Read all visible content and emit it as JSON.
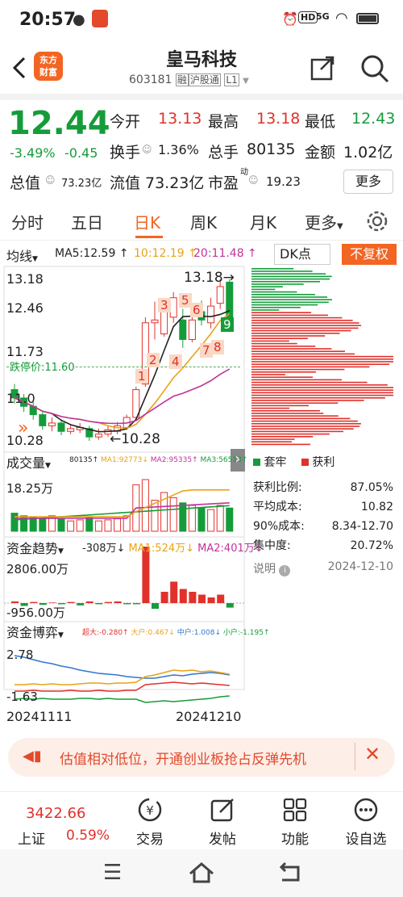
{
  "status": {
    "time": "20:57",
    "signal": "5G",
    "battery": "100"
  },
  "header": {
    "logo_line1": "东方",
    "logo_line2": "财富",
    "name": "皇马科技",
    "code": "603181",
    "tag1": "融",
    "tag2": "沪股通",
    "tag3": "L1"
  },
  "quote": {
    "price": "12.44",
    "change_pct": "-3.49%",
    "change": "-0.45",
    "open_label": "今开",
    "open": "13.13",
    "high_label": "最高",
    "high": "13.18",
    "low_label": "最低",
    "low": "12.43",
    "turnover_label": "换手",
    "turnover": "1.36%",
    "volume_label": "总手",
    "volume": "80135",
    "amount_label": "金额",
    "amount": "1.02亿",
    "mktcap_label": "总值",
    "mktcap": "73.23亿",
    "float_label": "流值",
    "float_cap": "73.23亿",
    "pe_label": "市盈",
    "pe_sup": "动",
    "pe": "19.23",
    "more_btn": "更多"
  },
  "tabs": [
    "分时",
    "五日",
    "日K",
    "周K",
    "月K",
    "更多"
  ],
  "tabs_active": "日K",
  "indicator_bar": {
    "ma_select": "均线",
    "ma5": "MA5:12.59 ↑",
    "ma10": "10:12.19 ↑",
    "ma20": "20:11.48 ↑",
    "dk_btn": "DK点",
    "fq_btn": "不复权"
  },
  "price_axis": [
    "13.18",
    "12.46",
    "11.73",
    "11.0",
    "10.28"
  ],
  "limit_down_label": "跌停价:11.60",
  "high_marker": "13.18",
  "low_marker": "10.28",
  "volume_panel": {
    "label": "成交量",
    "legend": [
      "80135↑",
      "MA1:92773↓",
      "MA2:95335↑",
      "MA3:56513↑"
    ],
    "axis": "18.25万"
  },
  "fund_trend": {
    "label": "资金趋势",
    "legend": [
      "-308万↓",
      "MA1:524万↓",
      "MA2:401万↓"
    ],
    "axis_top": "2806.00万",
    "axis_bottom": "-956.00万"
  },
  "fund_game": {
    "label": "资金博弈",
    "legend": [
      "超大:-0.280↑",
      "大户:0.467↓",
      "中户:1.008↓",
      "小户:-1.195↑"
    ],
    "axis_top": "2.78",
    "axis_bottom": "-1.63"
  },
  "date_axis": {
    "start": "20241111",
    "end": "20241210"
  },
  "chip": {
    "legend_green": "套牢",
    "legend_red": "获利",
    "rows": [
      {
        "label": "获利比例:",
        "value": "87.05%"
      },
      {
        "label": "平均成本:",
        "value": "10.82"
      },
      {
        "label": "90%成本:",
        "value": "8.34-12.70"
      },
      {
        "label": "集中度:",
        "value": "20.72%"
      }
    ],
    "note": "说明",
    "date": "2024-12-10"
  },
  "dk_markers": [
    "1",
    "2",
    "3",
    "4",
    "5",
    "6",
    "7",
    "8",
    "9"
  ],
  "banner_text": "估值相对低位，开通创业板抢占反弹先机",
  "bottom_nav": {
    "index_value": "3422.66",
    "index_name": "上证",
    "index_change": "0.59%",
    "items": [
      "交易",
      "发帖",
      "功能",
      "设自选"
    ]
  },
  "colors": {
    "up": "#e0312b",
    "down": "#159c3a",
    "ma5": "#222222",
    "ma10": "#e8a317",
    "ma20": "#c0339a",
    "accent": "#f26522"
  }
}
